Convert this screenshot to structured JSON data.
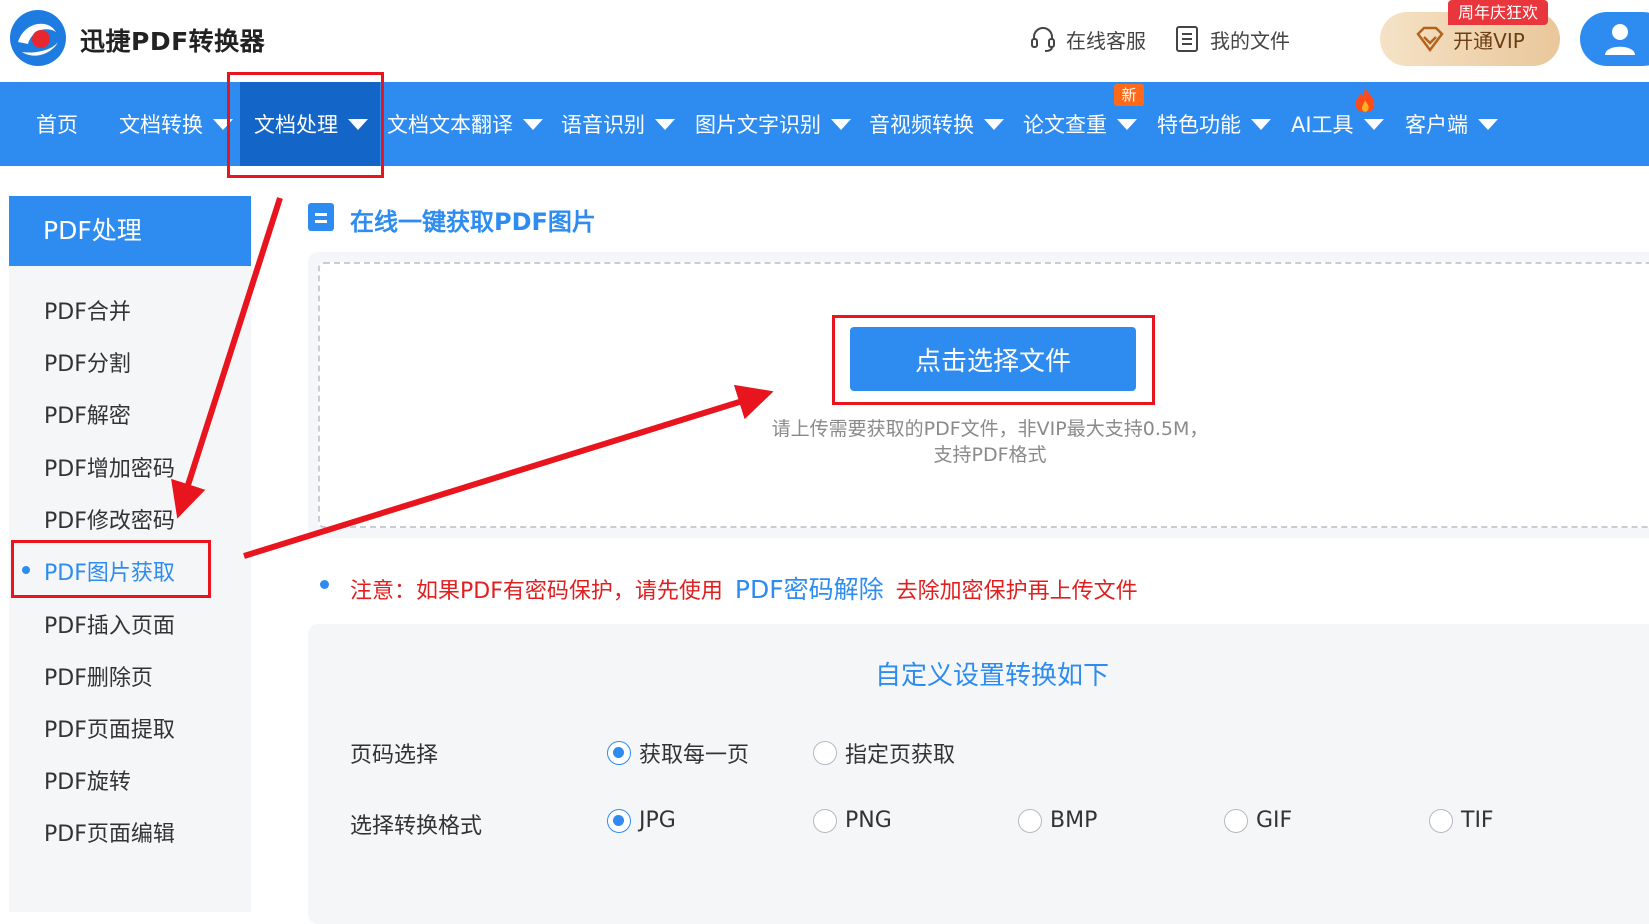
{
  "header": {
    "brand": "迅捷PDF转换器",
    "service": "在线客服",
    "my_files": "我的文件",
    "vip_label": "开通VIP",
    "vip_tag": "周年庆狂欢"
  },
  "nav": {
    "items": [
      "首页",
      "文档转换",
      "文档处理",
      "文档文本翻译",
      "语音识别",
      "图片文字识别",
      "音视频转换",
      "论文查重",
      "特色功能",
      "AI工具",
      "客户端"
    ],
    "new_badge": "新"
  },
  "sidebar": {
    "title": "PDF处理",
    "items": [
      "PDF合并",
      "PDF分割",
      "PDF解密",
      "PDF增加密码",
      "PDF修改密码",
      "PDF图片获取",
      "PDF插入页面",
      "PDF删除页",
      "PDF页面提取",
      "PDF旋转",
      "PDF页面编辑"
    ]
  },
  "main": {
    "section_title": "在线一键获取PDF图片",
    "choose_button": "点击选择文件",
    "hint_line1": "请上传需要获取的PDF文件，非VIP最大支持0.5M，",
    "hint_line2": "支持PDF格式",
    "notice_before": "注意：如果PDF有密码保护，请先使用",
    "notice_link": "PDF密码解除",
    "notice_after": "去除加密保护再上传文件"
  },
  "settings": {
    "title": "自定义设置转换如下",
    "page_label": "页码选择",
    "page_options": [
      "获取每一页",
      "指定页获取"
    ],
    "format_label": "选择转换格式",
    "format_options": [
      "JPG",
      "PNG",
      "BMP",
      "GIF",
      "TIF"
    ]
  },
  "colors": {
    "primary": "#2e8cf0",
    "active_nav": "#1366c8",
    "annotation_red": "#e8141e",
    "notice_red": "#e02020"
  }
}
